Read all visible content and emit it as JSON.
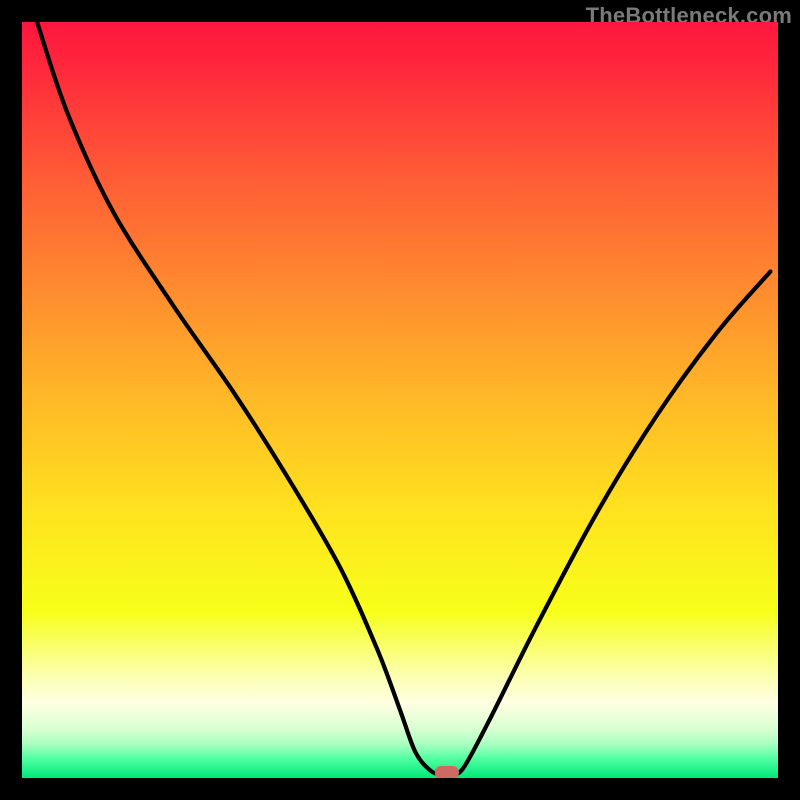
{
  "watermark": "TheBottleneck.com",
  "chart_data": {
    "type": "line",
    "title": "",
    "xlabel": "",
    "ylabel": "",
    "xlim": [
      0,
      100
    ],
    "ylim": [
      0,
      100
    ],
    "grid": false,
    "legend": false,
    "background_gradient": {
      "stops": [
        {
          "pos": 0.0,
          "color": "#ff163e"
        },
        {
          "pos": 0.07,
          "color": "#ff2b3b"
        },
        {
          "pos": 0.2,
          "color": "#ff5a36"
        },
        {
          "pos": 0.35,
          "color": "#ff8a2f"
        },
        {
          "pos": 0.5,
          "color": "#ffb927"
        },
        {
          "pos": 0.65,
          "color": "#ffe31e"
        },
        {
          "pos": 0.78,
          "color": "#f7ff1a"
        },
        {
          "pos": 0.86,
          "color": "#fbffa8"
        },
        {
          "pos": 0.9,
          "color": "#ffffe2"
        },
        {
          "pos": 0.935,
          "color": "#d9ffd2"
        },
        {
          "pos": 0.955,
          "color": "#a8ffc0"
        },
        {
          "pos": 0.975,
          "color": "#4fffa0"
        },
        {
          "pos": 1.0,
          "color": "#00e97a"
        }
      ]
    },
    "series": [
      {
        "name": "bottleneck-curve",
        "x": [
          2,
          6,
          12,
          20,
          28,
          35,
          42,
          47,
          50,
          52,
          54,
          55.5,
          57,
          58.5,
          62,
          68,
          76,
          84,
          92,
          99
        ],
        "values": [
          100,
          88,
          75,
          62.5,
          51,
          40,
          28,
          17,
          9,
          3.5,
          1,
          0.5,
          0.5,
          1.5,
          8,
          20,
          35,
          48,
          59,
          67
        ]
      },
      {
        "name": "minimum-marker",
        "marker": true,
        "x": [
          56.2
        ],
        "values": [
          0.8
        ],
        "color": "#cf6a63"
      }
    ],
    "minimum_at_x": 56
  }
}
